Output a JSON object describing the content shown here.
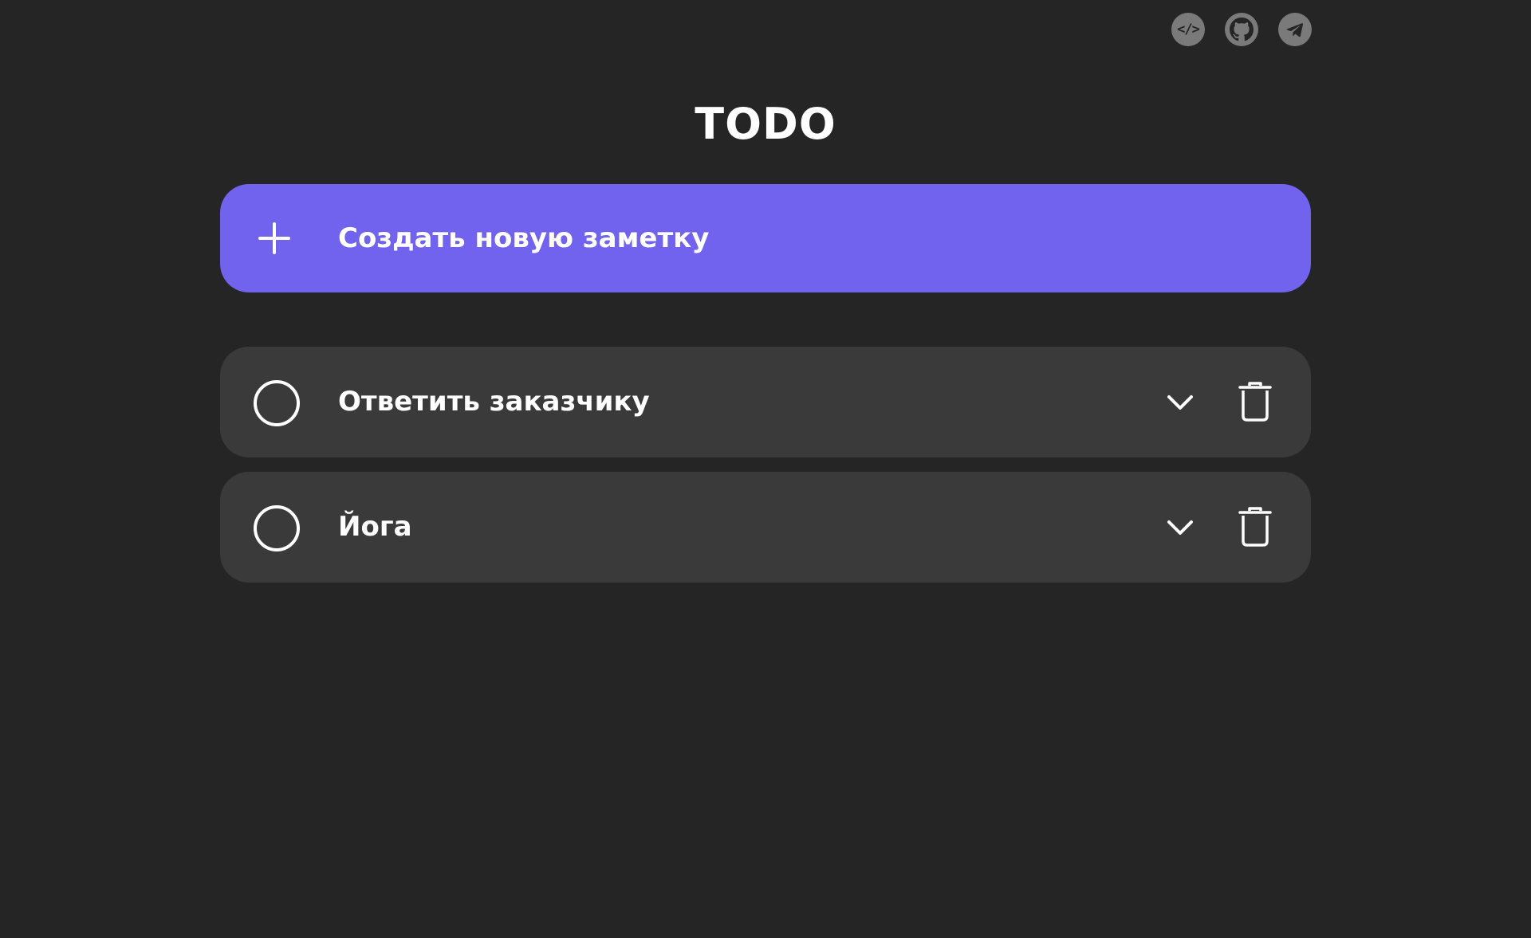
{
  "header": {
    "title": "TODO",
    "social_links": [
      {
        "name": "code-icon",
        "glyph": "</>"
      },
      {
        "name": "github-icon"
      },
      {
        "name": "telegram-icon"
      }
    ]
  },
  "create_button": {
    "label": "Создать новую заметку",
    "icon": "plus-icon"
  },
  "todos": [
    {
      "text": "Ответить заказчику",
      "completed": false
    },
    {
      "text": "Йога",
      "completed": false
    }
  ],
  "colors": {
    "background": "#252525",
    "accent": "#7163ee",
    "card": "#3a3a3a",
    "social_icon": "#7a7a7a",
    "text": "#ffffff"
  }
}
